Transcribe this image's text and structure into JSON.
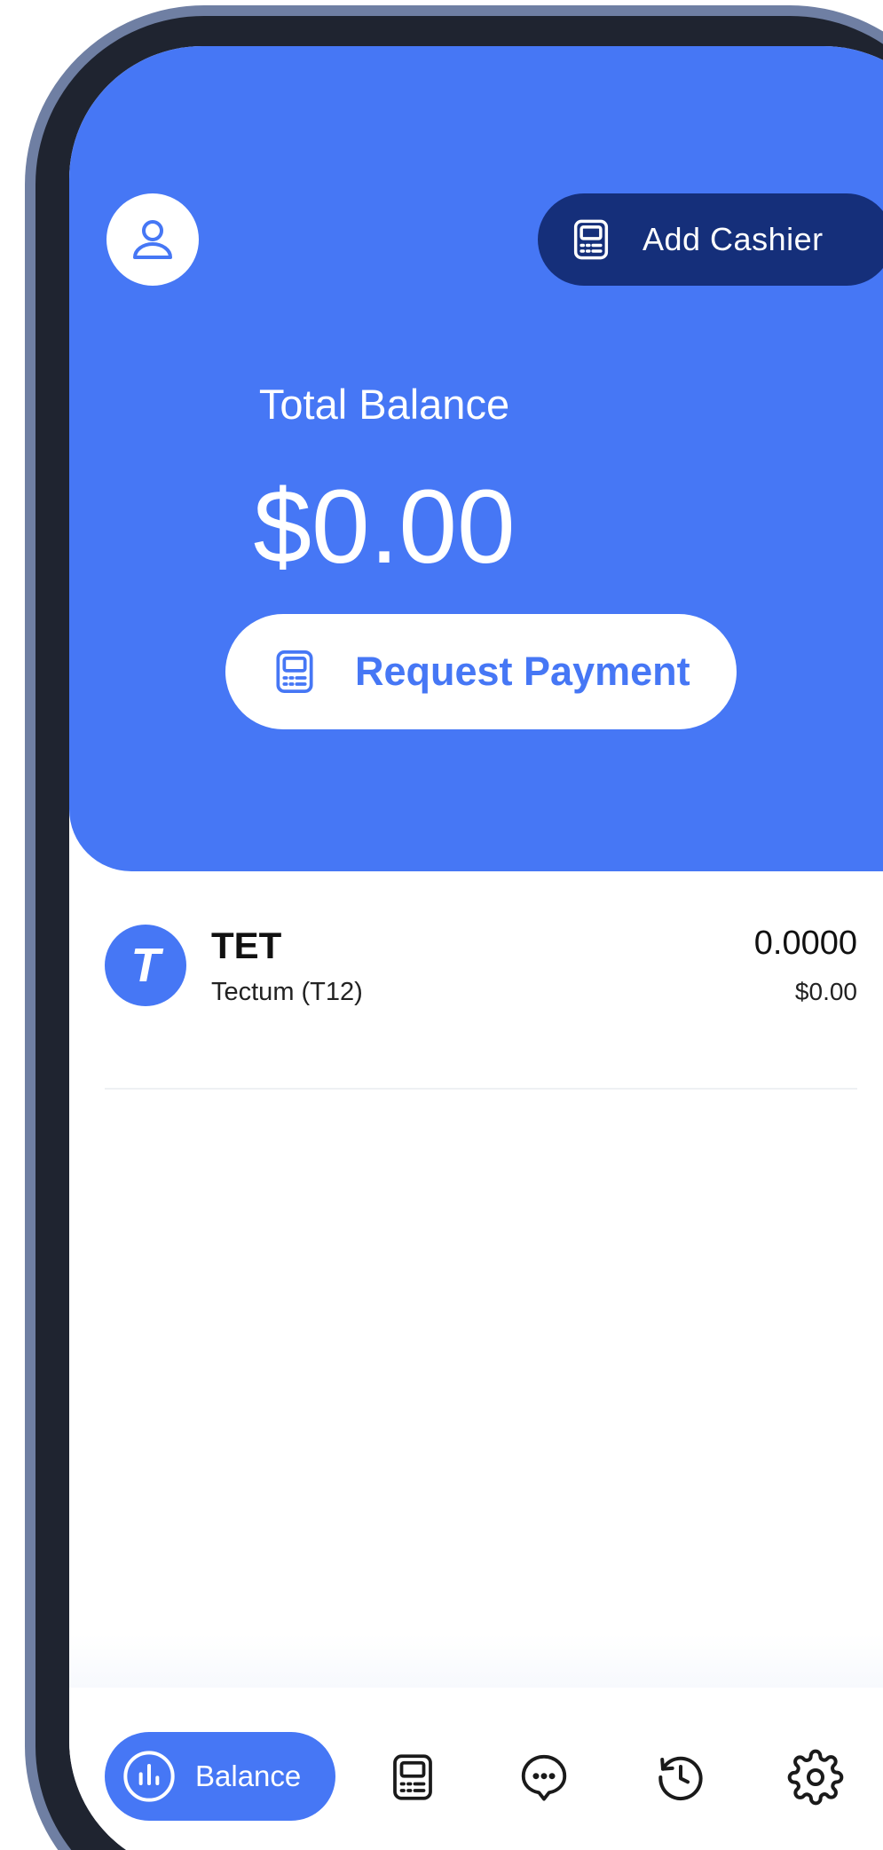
{
  "header": {
    "add_cashier_label": "Add Cashier"
  },
  "balance": {
    "title": "Total Balance",
    "amount": "$0.00",
    "request_payment_label": "Request Payment"
  },
  "tokens": [
    {
      "symbol": "TET",
      "name": "Tectum (T12)",
      "amount": "0.0000",
      "fiat_value": "$0.00",
      "icon_letter": "T"
    }
  ],
  "nav": {
    "items": [
      {
        "label": "Balance",
        "icon": "chart-bars-icon",
        "active": true
      },
      {
        "label": "",
        "icon": "pos-terminal-icon",
        "active": false
      },
      {
        "label": "",
        "icon": "chat-bubble-icon",
        "active": false
      },
      {
        "label": "",
        "icon": "history-icon",
        "active": false
      },
      {
        "label": "",
        "icon": "settings-gear-icon",
        "active": false
      }
    ]
  },
  "colors": {
    "primary": "#4677f5",
    "dark_button": "#152f7a",
    "frame": "#6f7fa3"
  }
}
